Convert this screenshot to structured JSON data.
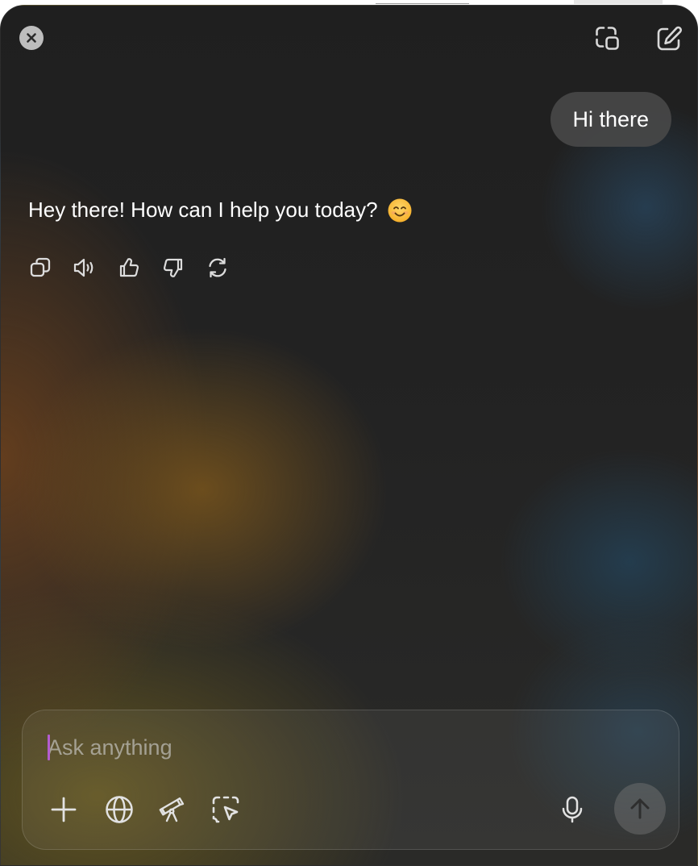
{
  "header": {
    "close_icon": "close-icon",
    "new_window_icon": "new-window-icon",
    "compose_icon": "compose-icon"
  },
  "conversation": {
    "user_message": "Hi there",
    "assistant_message": "Hey there! How can I help you today?",
    "assistant_emoji": "smiling-face-emoji"
  },
  "message_actions": [
    {
      "name": "copy",
      "icon": "copy-icon"
    },
    {
      "name": "read-aloud",
      "icon": "speaker-icon"
    },
    {
      "name": "good-response",
      "icon": "thumbs-up-icon"
    },
    {
      "name": "bad-response",
      "icon": "thumbs-down-icon"
    },
    {
      "name": "regenerate",
      "icon": "refresh-icon"
    }
  ],
  "composer": {
    "placeholder": "Ask anything",
    "value": "",
    "tools": [
      "plus-icon",
      "globe-icon",
      "telescope-icon",
      "screen-select-icon"
    ],
    "mic_icon": "microphone-icon",
    "send_icon": "arrow-up-icon"
  },
  "colors": {
    "background": "#222222",
    "bubble": "#484848",
    "text": "#ffffff",
    "caret": "#b35cd0"
  }
}
